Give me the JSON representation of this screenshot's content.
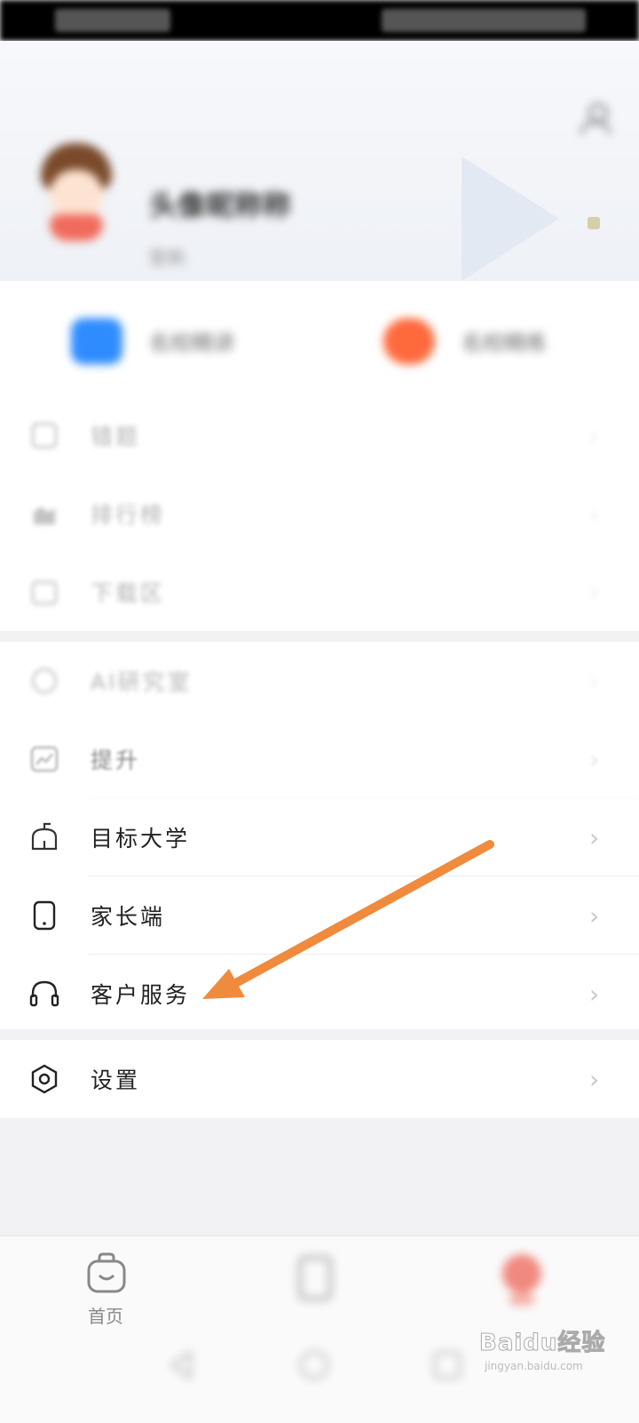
{
  "status_bar": {},
  "profile": {
    "username": "头像昵称称",
    "subtitle": "签到"
  },
  "quick_actions": [
    {
      "label": "名校精讲",
      "color": "#2f8cff"
    },
    {
      "label": "名校精练",
      "color": "#ff6a3d"
    }
  ],
  "menu_group_1": [
    {
      "label": "错题",
      "icon": "notebook-icon"
    },
    {
      "label": "排行榜",
      "icon": "trophy-icon"
    },
    {
      "label": "下载区",
      "icon": "folder-icon"
    }
  ],
  "menu_group_2": [
    {
      "label": "AI研究室",
      "icon": "ai-icon"
    },
    {
      "label": "提升",
      "icon": "chart-icon"
    },
    {
      "label": "目标大学",
      "icon": "university-icon"
    },
    {
      "label": "家长端",
      "icon": "phone-icon"
    },
    {
      "label": "客户服务",
      "icon": "headset-icon"
    }
  ],
  "menu_group_3": [
    {
      "label": "设置",
      "icon": "settings-hexagon-icon"
    }
  ],
  "bottom_tabs": [
    {
      "label": "首页",
      "icon": "bag-icon"
    },
    {
      "label": "",
      "icon": "book-icon"
    },
    {
      "label": "",
      "icon": "profile-icon"
    }
  ],
  "annotation": {
    "color": "#f08a3c"
  },
  "watermark": {
    "brand": "Baidu经验",
    "url": "jingyan.baidu.com"
  }
}
